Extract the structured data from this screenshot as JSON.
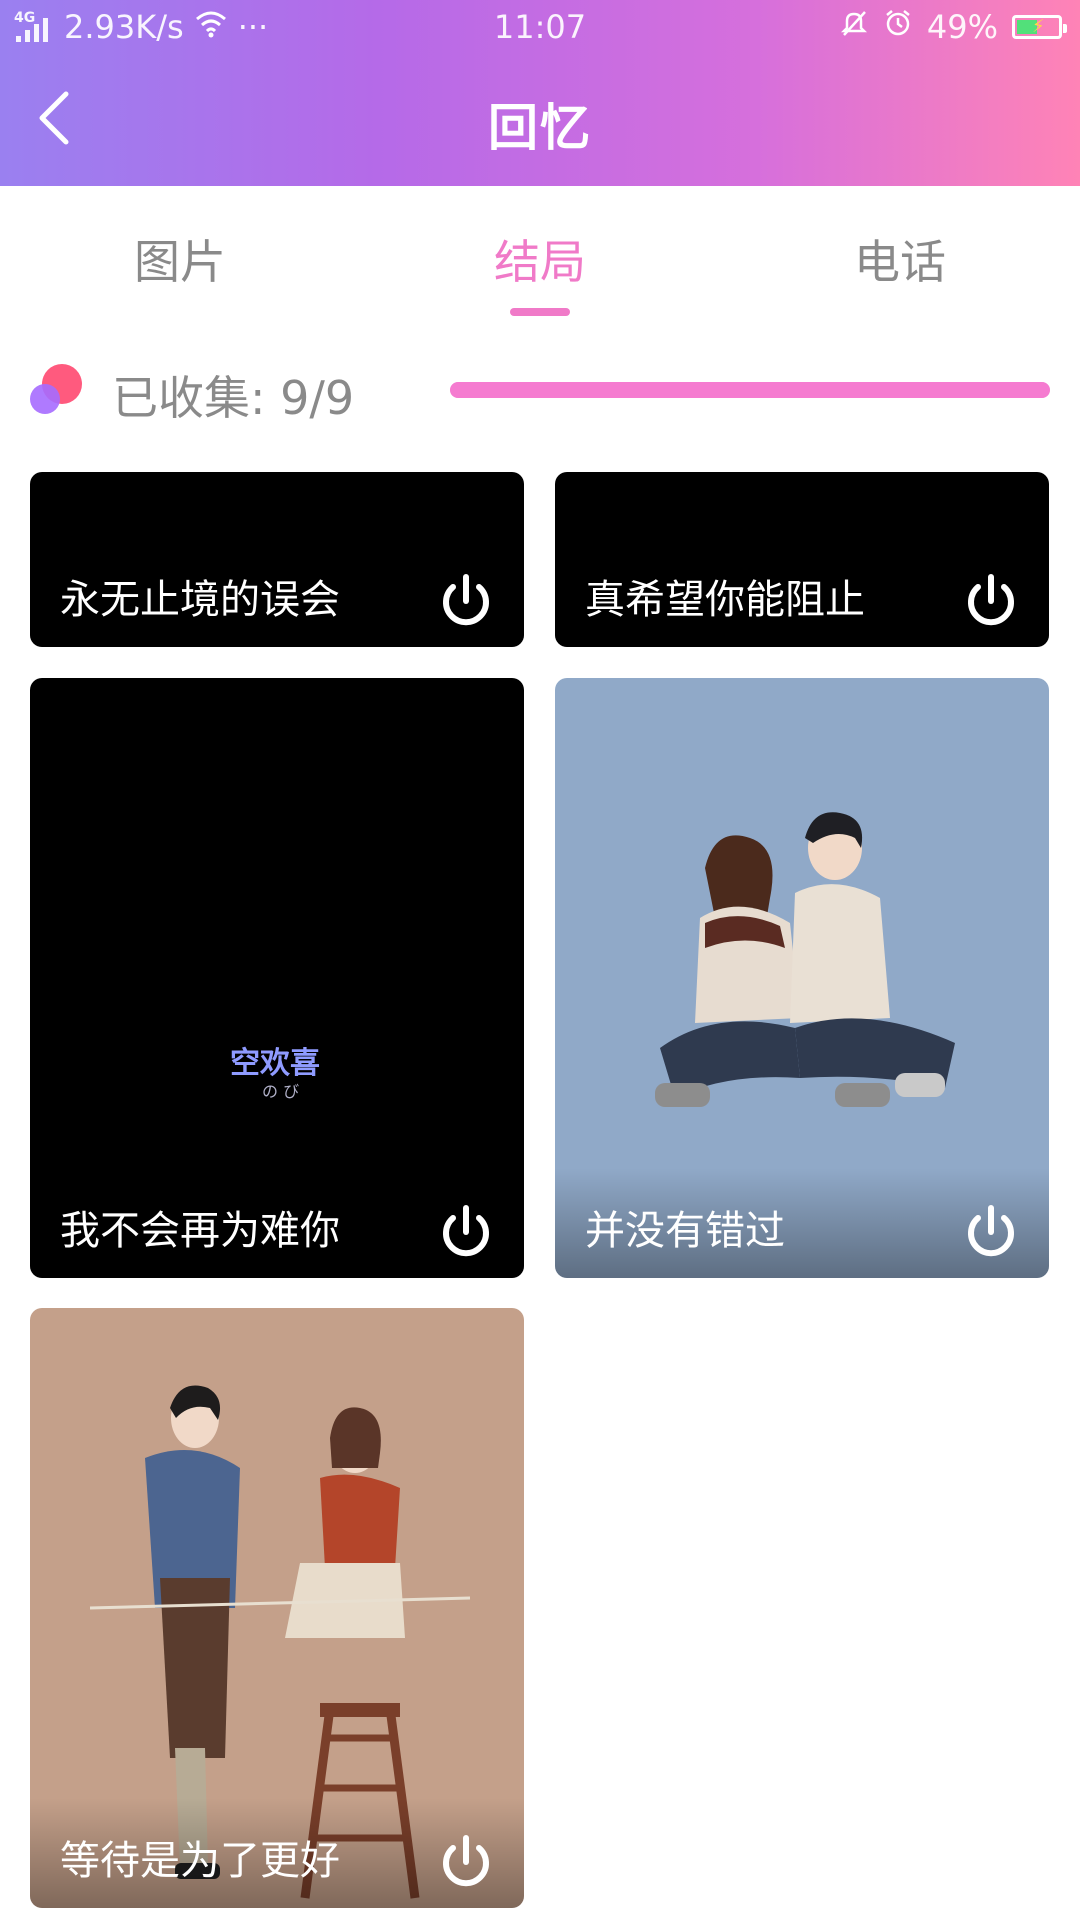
{
  "status": {
    "network": "4G",
    "speed": "2.93K/s",
    "more": "···",
    "time": "11:07",
    "battery_percent": "49%",
    "battery_level": 0.49
  },
  "header": {
    "title": "回忆"
  },
  "tabs": [
    {
      "label": "图片",
      "active": false
    },
    {
      "label": "结局",
      "active": true
    },
    {
      "label": "电话",
      "active": false
    }
  ],
  "collected": {
    "label": "已收集: 9/9",
    "progress": 1.0
  },
  "cards": [
    {
      "caption": "永无止境的误会",
      "image": "dark-scene"
    },
    {
      "caption": "真希望你能阻止",
      "image": "dark-scene"
    },
    {
      "caption": "我不会再为难你",
      "image": "dark-scene",
      "art_title": "空欢喜",
      "art_sub": "の び"
    },
    {
      "caption": "并没有错过",
      "image": "couple-sitting-illustration",
      "bg": "#90a9c8"
    },
    {
      "caption": "等待是为了更好",
      "image": "couple-ladder-illustration",
      "bg": "#c4a08a"
    }
  ],
  "colors": {
    "accent": "#f07ac8",
    "header_gradient_start": "#9a80f0",
    "header_gradient_end": "#ff83b6"
  }
}
